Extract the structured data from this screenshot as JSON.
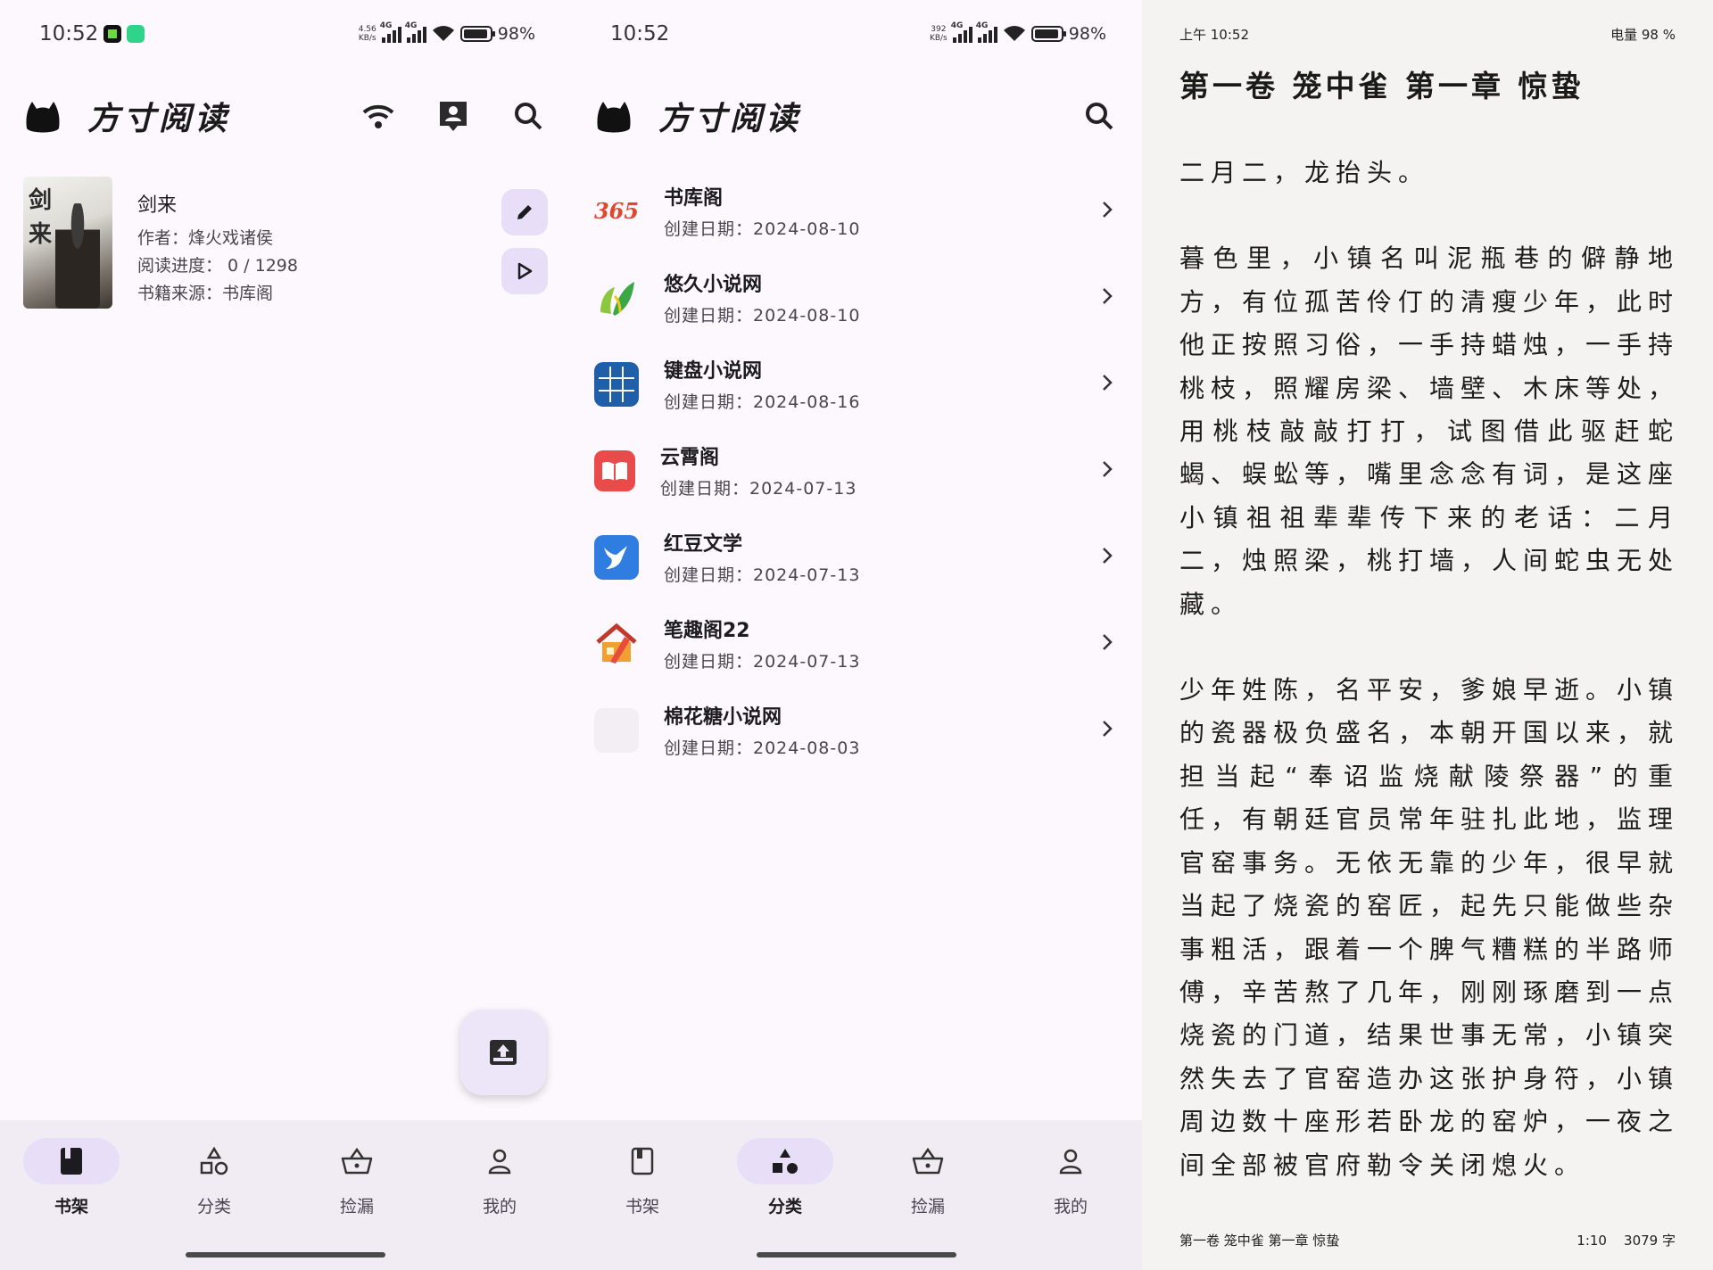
{
  "colors": {
    "accent_container": "#e8def8",
    "nav_background": "#f1ecf4",
    "screen_background": "#fdf8fd",
    "reader_background": "#f4f3f1"
  },
  "screen1": {
    "status": {
      "time": "10:52",
      "netspeed_value": "4.56",
      "netspeed_unit": "KB/s",
      "net1": "4G",
      "net2": "4G",
      "battery": "98%",
      "battery_level": 0.98
    },
    "app_title": "方寸阅读",
    "actions": [
      "wifi-icon",
      "contact-icon",
      "search-icon"
    ],
    "book": {
      "cover_text_1": "剑",
      "cover_text_2": "来",
      "title": "剑来",
      "author": "作者：烽火戏诸侯",
      "progress": "阅读进度： 0 / 1298",
      "source": "书籍来源：书库阁"
    }
  },
  "screen2": {
    "status": {
      "time": "10:52",
      "netspeed_value": "392",
      "netspeed_unit": "KB/s",
      "net1": "4G",
      "net2": "4G",
      "battery": "98%",
      "battery_level": 0.98
    },
    "app_title": "方寸阅读",
    "sources": [
      {
        "name": "书库阁",
        "date": "创建日期：2024-08-10",
        "icon_text": "365"
      },
      {
        "name": "悠久小说网",
        "date": "创建日期：2024-08-10",
        "icon_text": ""
      },
      {
        "name": "键盘小说网",
        "date": "创建日期：2024-08-16",
        "icon_text": ""
      },
      {
        "name": "云霄阁",
        "date": "创建日期：2024-07-13",
        "icon_text": ""
      },
      {
        "name": "红豆文学",
        "date": "创建日期：2024-07-13",
        "icon_text": ""
      },
      {
        "name": "笔趣阁22",
        "date": "创建日期：2024-07-13",
        "icon_text": ""
      },
      {
        "name": "棉花糖小说网",
        "date": "创建日期：2024-08-03",
        "icon_text": ""
      }
    ]
  },
  "nav": {
    "bookshelf": "书架",
    "category": "分类",
    "picks": "捡漏",
    "mine": "我的"
  },
  "reader": {
    "time": "上午 10:52",
    "battery": "电量 98 %",
    "chapter_title": "第一卷 笼中雀 第一章 惊蛰",
    "paragraphs": [
      "二月二，龙抬头。",
      "暮色里，小镇名叫泥瓶巷的僻静地方，有位孤苦伶仃的清瘦少年，此时他正按照习俗，一手持蜡烛，一手持桃枝，照耀房梁、墙壁、木床等处，用桃枝敲敲打打，试图借此驱赶蛇蝎、蜈蚣等，嘴里念念有词，是这座小镇祖祖辈辈传下来的老话：二月二，烛照梁，桃打墙，人间蛇虫无处藏。",
      "少年姓陈，名平安，爹娘早逝。小镇的瓷器极负盛名，本朝开国以来，就担当起“奉诏监烧献陵祭器”的重任，有朝廷官员常年驻扎此地，监理官窑事务。无依无靠的少年，很早就当起了烧瓷的窑匠，起先只能做些杂事粗活，跟着一个脾气糟糕的半路师傅，辛苦熬了几年，刚刚琢磨到一点烧瓷的门道，结果世事无常，小镇突然失去了官窑造办这张护身符，小镇周边数十座形若卧龙的窑炉，一夜之间全部被官府勒令关闭熄火。"
    ],
    "footer_chapter": "第一卷 笼中雀 第一章 惊蛰",
    "footer_page": "1:10",
    "footer_words": "3079 字"
  }
}
